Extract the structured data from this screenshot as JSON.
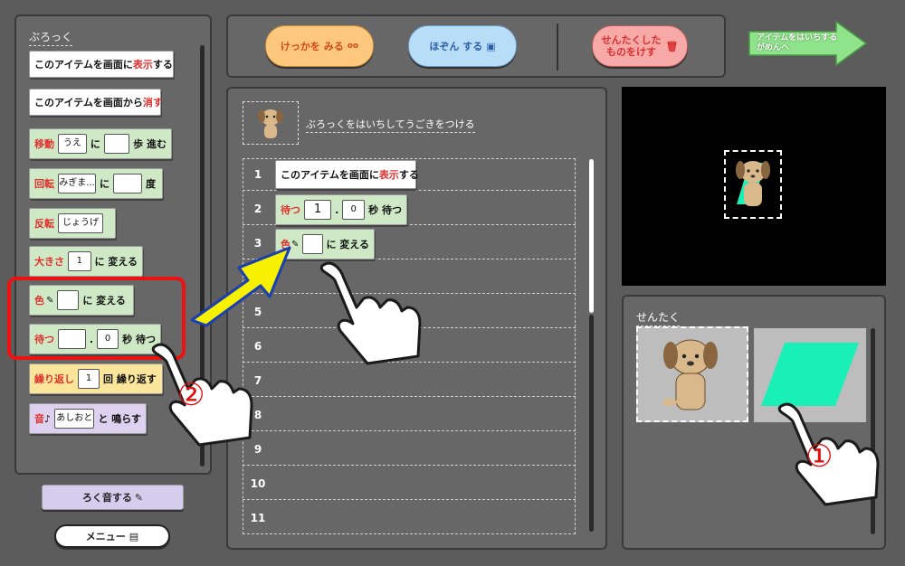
{
  "palette": {
    "title": "ぶろっく",
    "show_block": {
      "pre": "このアイテムを画面に",
      "key": "表示",
      "post": "する"
    },
    "hide_block": {
      "pre": "このアイテムを画面から",
      "key": "消す"
    },
    "move_block": {
      "key": "移動",
      "dir": "うえ",
      "mid": "に",
      "post": "歩 進む"
    },
    "rotate_block": {
      "key": "回転",
      "dir": "みぎま...",
      "mid": "に",
      "post": "度"
    },
    "flip_block": {
      "key": "反転",
      "dir": "じょうげ"
    },
    "size_block": {
      "key": "大きさ",
      "value": "1",
      "post": "に 変える"
    },
    "color_block": {
      "key": "色",
      "post": "に 変える"
    },
    "wait_block": {
      "key": "待つ",
      "dot": ".",
      "decimal": "0",
      "post": "秒 待つ"
    },
    "repeat_block": {
      "key": "繰り返し",
      "value": "1",
      "post": "回 繰り返す"
    },
    "sound_block": {
      "key": "音",
      "note": "♪",
      "value": "あしおと",
      "post": "と 鳴らす"
    }
  },
  "record_button": "ろく音する",
  "menu_button": "メニュー",
  "toolbar": {
    "result_button": "けっかを みる",
    "save_button": "ほぞん する",
    "delete_button_l1": "せんたくした",
    "delete_button_l2": "ものをけす",
    "next_button_l1": "アイテムをはいちする",
    "next_button_l2": "がめんへ"
  },
  "editor": {
    "hint": "ぶろっくをはいちしてうごきをつける",
    "rows": [
      "1",
      "2",
      "3",
      "4",
      "5",
      "6",
      "7",
      "8",
      "9",
      "10",
      "11"
    ],
    "row1": {
      "pre": "このアイテムを画面に",
      "key": "表示",
      "post": "する"
    },
    "row2": {
      "key": "待つ",
      "value": "1",
      "dot": ".",
      "decimal": "0",
      "post": "秒 待つ"
    },
    "row3": {
      "key": "色",
      "post": "に 変える"
    }
  },
  "selection": {
    "title": "せんたく"
  },
  "annotations": {
    "marker_one": "①",
    "marker_two": "②"
  },
  "colors": {
    "accent_red": "#e0302b",
    "shape_green": "#19f0b8",
    "highlight_red": "#ee1111",
    "arrow_yellow": "#f7f000"
  }
}
